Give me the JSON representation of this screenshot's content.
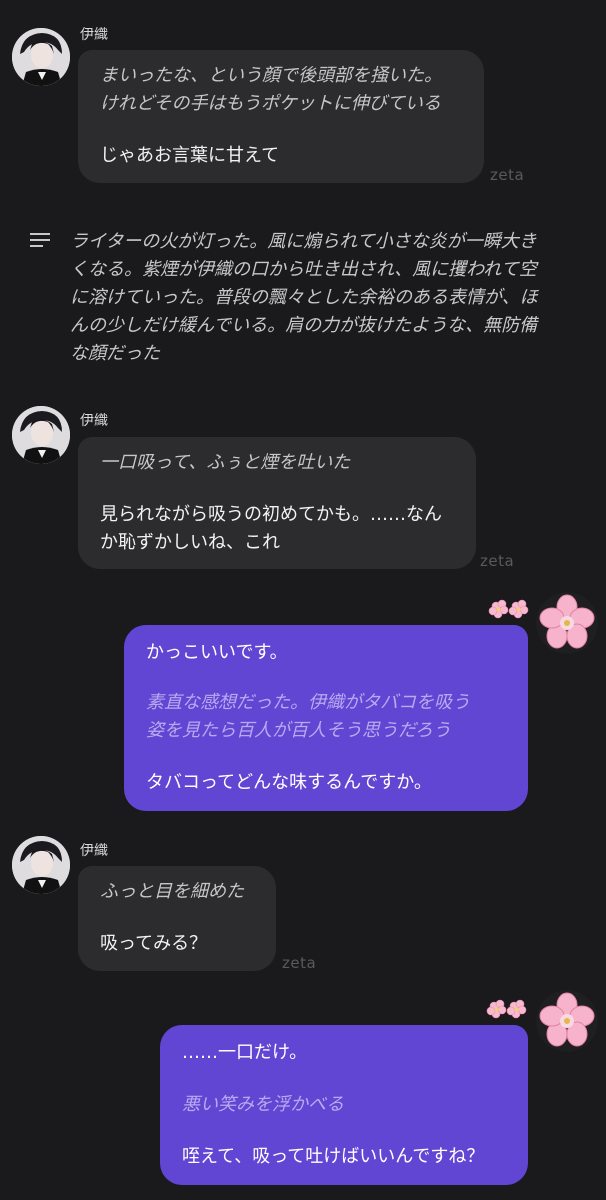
{
  "messages": [
    {
      "sender": "伊織",
      "lines": [
        "まいったな、という顔で後頭部を掻いた。",
        "けれどその手はもうポケットに伸びている",
        "じゃあお言葉に甘えて"
      ],
      "watermark": "zeta"
    },
    {
      "narration": [
        "ライターの火が灯った。風に煽られて小さな炎が一瞬大き",
        "くなる。紫煙が伊織の口から吐き出され、風に攫われて空",
        "に溶けていった。普段の飄々とした余裕のある表情が、ほ",
        "んの少しだけ緩んでいる。肩の力が抜けたような、無防備",
        "な顔だった"
      ]
    },
    {
      "sender": "伊織",
      "lines": [
        "一口吸って、ふぅと煙を吐いた",
        "見られながら吸うの初めてかも。……なん",
        "か恥ずかしいね、これ"
      ],
      "watermark": "zeta"
    },
    {
      "lines": [
        "かっこいいです。",
        "素直な感想だった。伊織がタバコを吸う",
        "姿を見たら百人が百人そう思うだろう",
        "タバコってどんな味するんですか。"
      ]
    },
    {
      "sender": "伊織",
      "lines": [
        "ふっと目を細めた",
        "吸ってみる？"
      ],
      "watermark": "zeta"
    },
    {
      "lines": [
        "……一口だけ。",
        "悪い笑みを浮かべる",
        "咥えて、吸って吐けばいいんですね？"
      ]
    }
  ],
  "icons": {
    "narration": "lines-icon",
    "character_avatar": "character-avatar",
    "user_avatar": "cherry-blossom-icon"
  },
  "colors": {
    "background": "#1a191c",
    "ai_bubble": "#2c2b2e",
    "user_bubble": "#6146d3"
  }
}
